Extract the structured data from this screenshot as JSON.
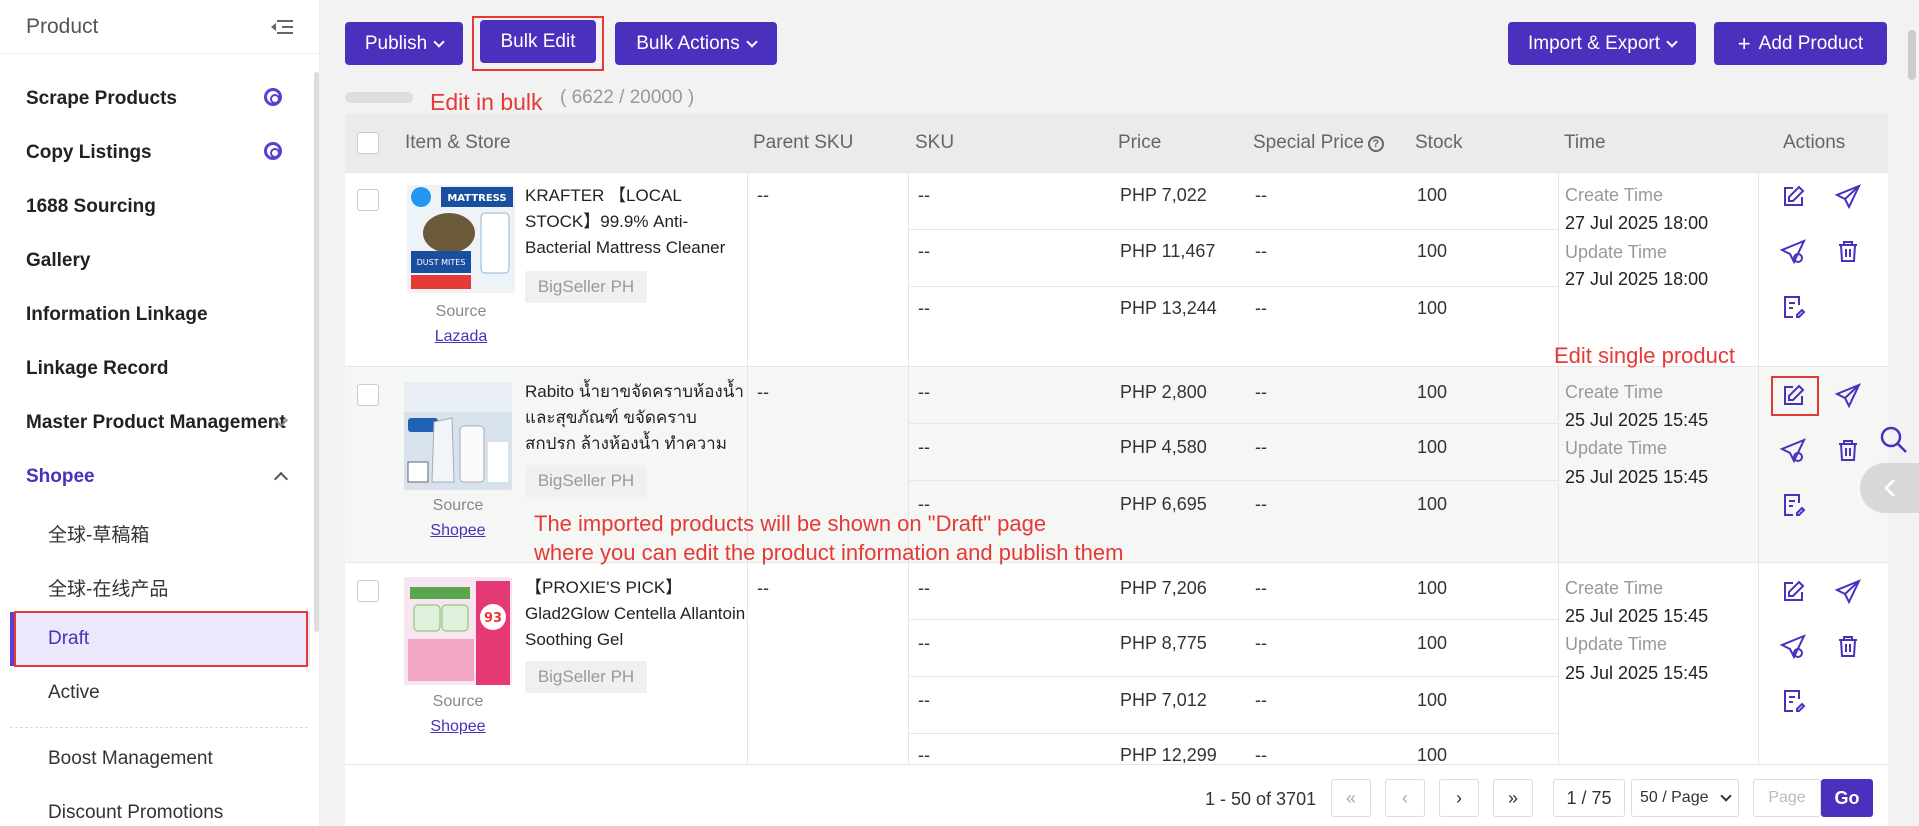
{
  "sidebar": {
    "title": "Product",
    "items": {
      "scrape": "Scrape Products",
      "copy": "Copy Listings",
      "sourcing": "1688 Sourcing",
      "gallery": "Gallery",
      "linkage": "Information Linkage",
      "record": "Linkage Record",
      "master": "Master Product Management",
      "shopee": "Shopee",
      "global_draft": "全球-草稿箱",
      "global_online": "全球-在线产品",
      "draft": "Draft",
      "active": "Active",
      "boost": "Boost Management",
      "discount": "Discount Promotions"
    }
  },
  "toolbar": {
    "publish": "Publish",
    "bulk_edit": "Bulk Edit",
    "bulk_actions": "Bulk Actions",
    "import_export": "Import & Export",
    "add_product": "Add Product",
    "count": "( 6622 / 20000 )"
  },
  "annotations": {
    "edit_bulk": "Edit in bulk",
    "edit_single": "Edit single product",
    "draft_line1": "The imported products will be shown on \"Draft\" page",
    "draft_line2": "where you can edit the product information and publish them"
  },
  "table": {
    "headers": {
      "item": "Item & Store",
      "parent_sku": "Parent SKU",
      "sku": "SKU",
      "price": "Price",
      "special": "Special Price",
      "stock": "Stock",
      "time": "Time",
      "actions": "Actions"
    },
    "create_label": "Create Time",
    "update_label": "Update Time",
    "source_label": "Source",
    "dash": "--",
    "rows": [
      {
        "name": "KRAFTER 【LOCAL STOCK】99.9% Anti-Bacterial Mattress Cleaner",
        "store": "BigSeller PH",
        "source": "Lazada",
        "parent_sku": "--",
        "variants": [
          {
            "sku": "--",
            "price": "PHP 7,022",
            "special": "--",
            "stock": "100"
          },
          {
            "sku": "--",
            "price": "PHP 11,467",
            "special": "--",
            "stock": "100"
          },
          {
            "sku": "--",
            "price": "PHP 13,244",
            "special": "--",
            "stock": "100"
          }
        ],
        "create": "27 Jul 2025 18:00",
        "update": "27 Jul 2025 18:00"
      },
      {
        "name": "Rabito น้ำยาขจัดคราบห้องน้ำ และสุขภัณฑ์ ขจัดคราบสกปรก ล้างห้องน้ำ ทำความสะอาด",
        "store": "BigSeller PH",
        "source": "Shopee",
        "parent_sku": "--",
        "variants": [
          {
            "sku": "--",
            "price": "PHP 2,800",
            "special": "--",
            "stock": "100"
          },
          {
            "sku": "--",
            "price": "PHP 4,580",
            "special": "--",
            "stock": "100"
          },
          {
            "sku": "--",
            "price": "PHP 6,695",
            "special": "--",
            "stock": "100"
          }
        ],
        "create": "25 Jul 2025 15:45",
        "update": "25 Jul 2025 15:45"
      },
      {
        "name": "【PROXIE'S PICK】 Glad2Glow Centella Allantoin Soothing Gel",
        "store": "BigSeller PH",
        "source": "Shopee",
        "parent_sku": "--",
        "variants": [
          {
            "sku": "--",
            "price": "PHP 7,206",
            "special": "--",
            "stock": "100"
          },
          {
            "sku": "--",
            "price": "PHP 8,775",
            "special": "--",
            "stock": "100"
          },
          {
            "sku": "--",
            "price": "PHP 7,012",
            "special": "--",
            "stock": "100"
          },
          {
            "sku": "--",
            "price": "PHP 12,299",
            "special": "--",
            "stock": "100"
          }
        ],
        "create": "25 Jul 2025 15:45",
        "update": "25 Jul 2025 15:45"
      }
    ]
  },
  "pagination": {
    "range": "1 - 50 of 3701",
    "page": "1 / 75",
    "page_size": "50 / Page",
    "page_placeholder": "Page",
    "go": "Go"
  },
  "colors": {
    "accent": "#4b2fbd",
    "annotation": "#e53935"
  },
  "icons": [
    "collapse-icon",
    "gear-icon",
    "chevron-down-icon",
    "chevron-up-icon",
    "edit-icon",
    "publish-icon",
    "quick-publish-icon",
    "delete-icon",
    "log-icon",
    "search-icon",
    "chevron-left-icon"
  ]
}
